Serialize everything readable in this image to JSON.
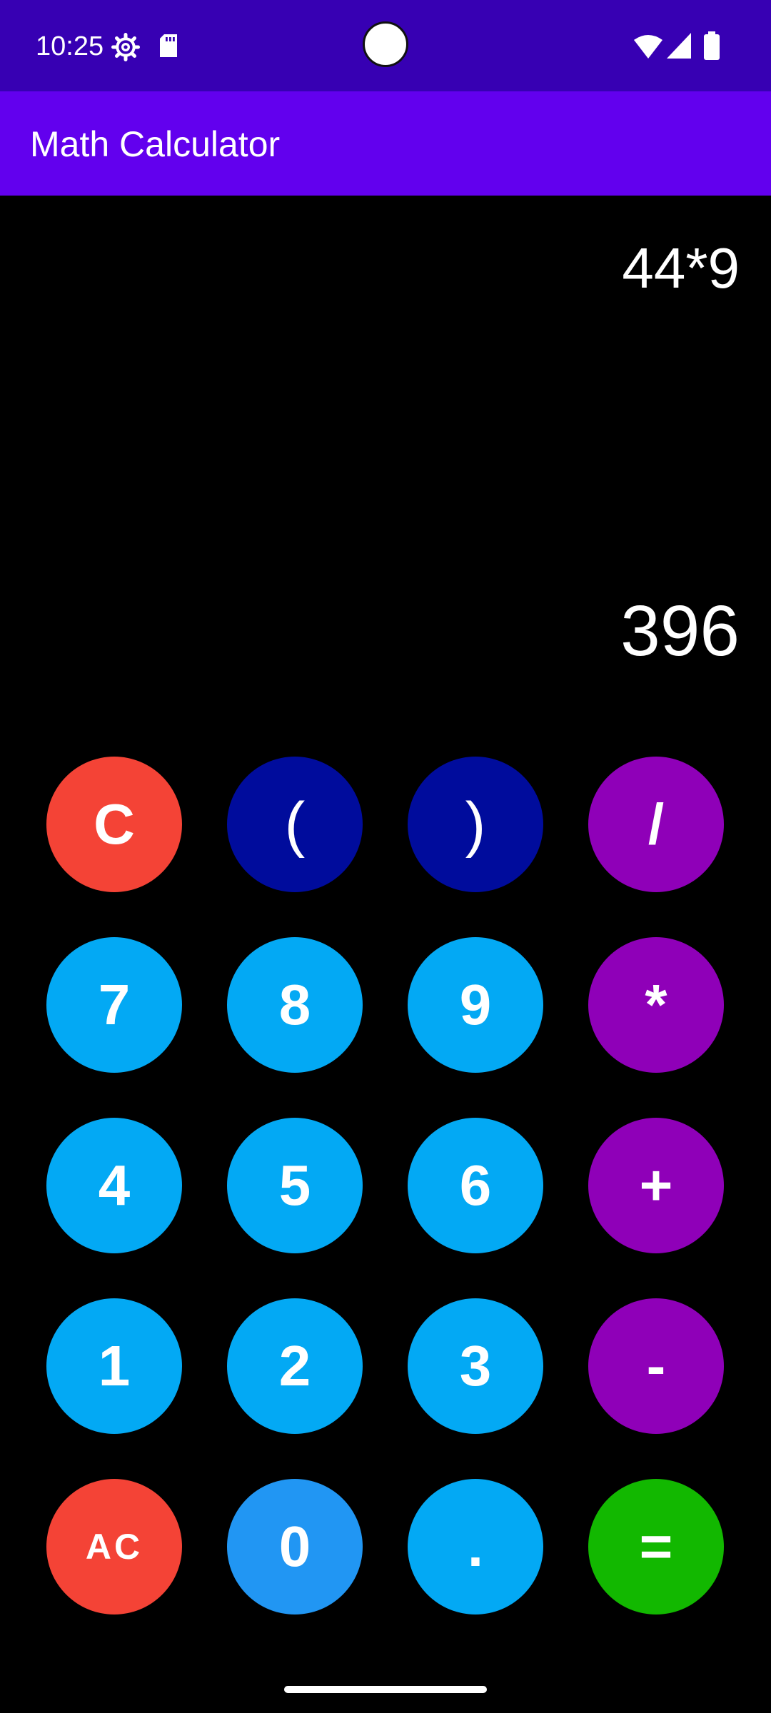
{
  "status_bar": {
    "time": "10:25",
    "icons": [
      "gear-icon",
      "sd-card-icon",
      "wifi-icon",
      "signal-icon",
      "battery-icon"
    ],
    "color": "#3700b3"
  },
  "app_bar": {
    "title": "Math Calculator",
    "color": "#6200ee"
  },
  "display": {
    "expression": "44*9",
    "result": "396"
  },
  "keypad": {
    "rows": [
      [
        {
          "label": "C",
          "color": "#f44336"
        },
        {
          "label": "(",
          "color": "#000c9c"
        },
        {
          "label": ")",
          "color": "#000c9c"
        },
        {
          "label": "/",
          "color": "#8f00b8"
        }
      ],
      [
        {
          "label": "7",
          "color": "#03a9f4"
        },
        {
          "label": "8",
          "color": "#03a9f4"
        },
        {
          "label": "9",
          "color": "#03a9f4"
        },
        {
          "label": "*",
          "color": "#8f00b8"
        }
      ],
      [
        {
          "label": "4",
          "color": "#03a9f4"
        },
        {
          "label": "5",
          "color": "#03a9f4"
        },
        {
          "label": "6",
          "color": "#03a9f4"
        },
        {
          "label": "+",
          "color": "#8f00b8"
        }
      ],
      [
        {
          "label": "1",
          "color": "#03a9f4"
        },
        {
          "label": "2",
          "color": "#03a9f4"
        },
        {
          "label": "3",
          "color": "#03a9f4"
        },
        {
          "label": "-",
          "color": "#8f00b8"
        }
      ],
      [
        {
          "label": "AC",
          "color": "#f44336"
        },
        {
          "label": "0",
          "color": "#2196f3"
        },
        {
          "label": ".",
          "color": "#03a9f4"
        },
        {
          "label": "=",
          "color": "#12b800"
        }
      ]
    ]
  }
}
